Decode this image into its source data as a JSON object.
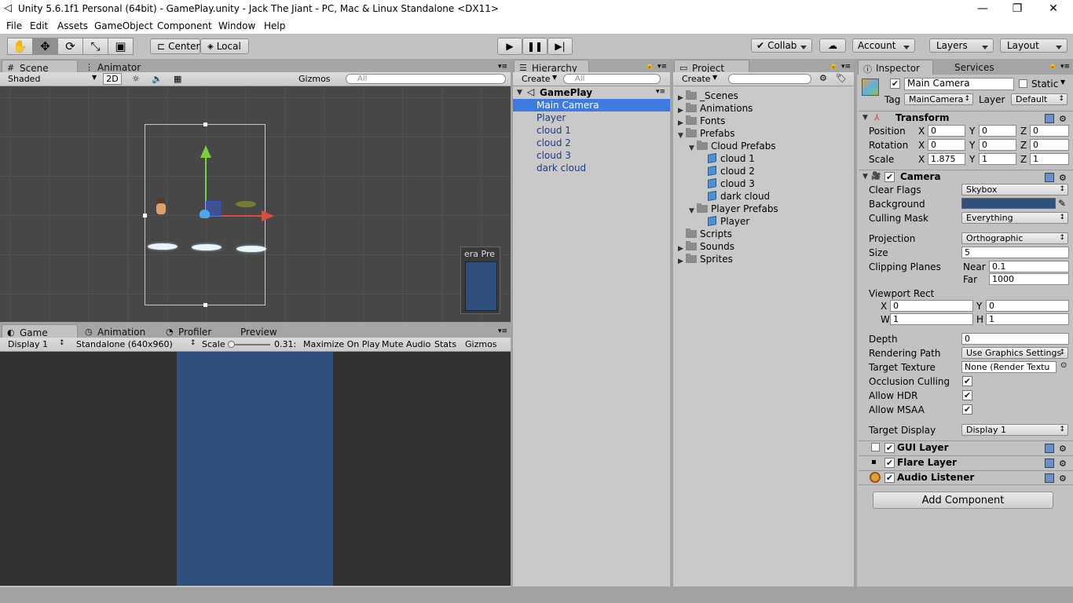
{
  "window": {
    "title": "Unity 5.6.1f1 Personal (64bit) - GamePlay.unity - Jack The Jiant - PC, Mac & Linux Standalone <DX11>",
    "minimize": "—",
    "maximize": "❐",
    "close": "✕"
  },
  "menu": [
    "File",
    "Edit",
    "Assets",
    "GameObject",
    "Component",
    "Window",
    "Help"
  ],
  "toolbar": {
    "center": "Center",
    "local": "Local",
    "collab": "Collab",
    "account": "Account",
    "layers": "Layers",
    "layout": "Layout"
  },
  "scene": {
    "tab_scene": "Scene",
    "tab_animator": "Animator",
    "shading": "Shaded",
    "mode2d": "2D",
    "gizmos": "Gizmos",
    "search": "All",
    "preview_label": "era Pre"
  },
  "game": {
    "tab_game": "Game",
    "tab_animation": "Animation",
    "tab_profiler": "Profiler",
    "preview": "Preview",
    "display": "Display 1",
    "resolution": "Standalone (640x960)",
    "scale_label": "Scale",
    "scale_value": "0.31:",
    "maximize": "Maximize On Play",
    "mute": "Mute Audio",
    "stats": "Stats",
    "gizmos": "Gizmos",
    "camera_color": "#2f4f7d"
  },
  "hierarchy": {
    "tab": "Hierarchy",
    "create": "Create",
    "search": "All",
    "scene": "GamePlay",
    "items": [
      "Main Camera",
      "Player",
      "cloud 1",
      "cloud 2",
      "cloud 3",
      "dark cloud"
    ],
    "selected": "Main Camera"
  },
  "project": {
    "tab": "Project",
    "create": "Create",
    "tree": [
      {
        "label": "_Scenes",
        "type": "folder",
        "depth": 0,
        "arrow": "▶"
      },
      {
        "label": "Animations",
        "type": "folder",
        "depth": 0,
        "arrow": "▶"
      },
      {
        "label": "Fonts",
        "type": "folder",
        "depth": 0,
        "arrow": "▶"
      },
      {
        "label": "Prefabs",
        "type": "folder",
        "depth": 0,
        "arrow": "▼"
      },
      {
        "label": "Cloud Prefabs",
        "type": "folder",
        "depth": 1,
        "arrow": "▼"
      },
      {
        "label": "cloud 1",
        "type": "prefab",
        "depth": 2,
        "arrow": ""
      },
      {
        "label": "cloud 2",
        "type": "prefab",
        "depth": 2,
        "arrow": ""
      },
      {
        "label": "cloud 3",
        "type": "prefab",
        "depth": 2,
        "arrow": ""
      },
      {
        "label": "dark cloud",
        "type": "prefab",
        "depth": 2,
        "arrow": ""
      },
      {
        "label": "Player Prefabs",
        "type": "folder",
        "depth": 1,
        "arrow": "▼"
      },
      {
        "label": "Player",
        "type": "prefab",
        "depth": 2,
        "arrow": ""
      },
      {
        "label": "Scripts",
        "type": "folder",
        "depth": 0,
        "arrow": ""
      },
      {
        "label": "Sounds",
        "type": "folder",
        "depth": 0,
        "arrow": "▶"
      },
      {
        "label": "Sprites",
        "type": "folder",
        "depth": 0,
        "arrow": "▶"
      }
    ]
  },
  "inspector": {
    "tab": "Inspector",
    "services": "Services",
    "name": "Main Camera",
    "static": "Static",
    "tag_label": "Tag",
    "tag": "MainCamera",
    "layer_label": "Layer",
    "layer": "Default",
    "transform": {
      "title": "Transform",
      "position_label": "Position",
      "rotation_label": "Rotation",
      "scale_label": "Scale",
      "x": "X",
      "y": "Y",
      "z": "Z",
      "position": [
        "0",
        "0",
        "0"
      ],
      "rotation": [
        "0",
        "0",
        "0"
      ],
      "scale": [
        "1.875",
        "1",
        "1"
      ]
    },
    "camera": {
      "title": "Camera",
      "clear_flags_label": "Clear Flags",
      "clear_flags": "Skybox",
      "background_label": "Background",
      "background_color": "#2f4f7d",
      "culling_mask_label": "Culling Mask",
      "culling_mask": "Everything",
      "projection_label": "Projection",
      "projection": "Orthographic",
      "size_label": "Size",
      "size": "5",
      "clipping_label": "Clipping Planes",
      "near_label": "Near",
      "near": "0.1",
      "far_label": "Far",
      "far": "1000",
      "viewport_label": "Viewport Rect",
      "vx_label": "X",
      "vx": "0",
      "vy_label": "Y",
      "vy": "0",
      "vw_label": "W",
      "vw": "1",
      "vh_label": "H",
      "vh": "1",
      "depth_label": "Depth",
      "depth": "0",
      "rendering_path_label": "Rendering Path",
      "rendering_path": "Use Graphics Settings",
      "target_texture_label": "Target Texture",
      "target_texture": "None (Render Textu",
      "occlusion_label": "Occlusion Culling",
      "hdr_label": "Allow HDR",
      "msaa_label": "Allow MSAA",
      "target_display_label": "Target Display",
      "target_display": "Display 1"
    },
    "gui_layer": "GUI Layer",
    "flare_layer": "Flare Layer",
    "audio_listener": "Audio Listener",
    "add_component": "Add Component"
  }
}
